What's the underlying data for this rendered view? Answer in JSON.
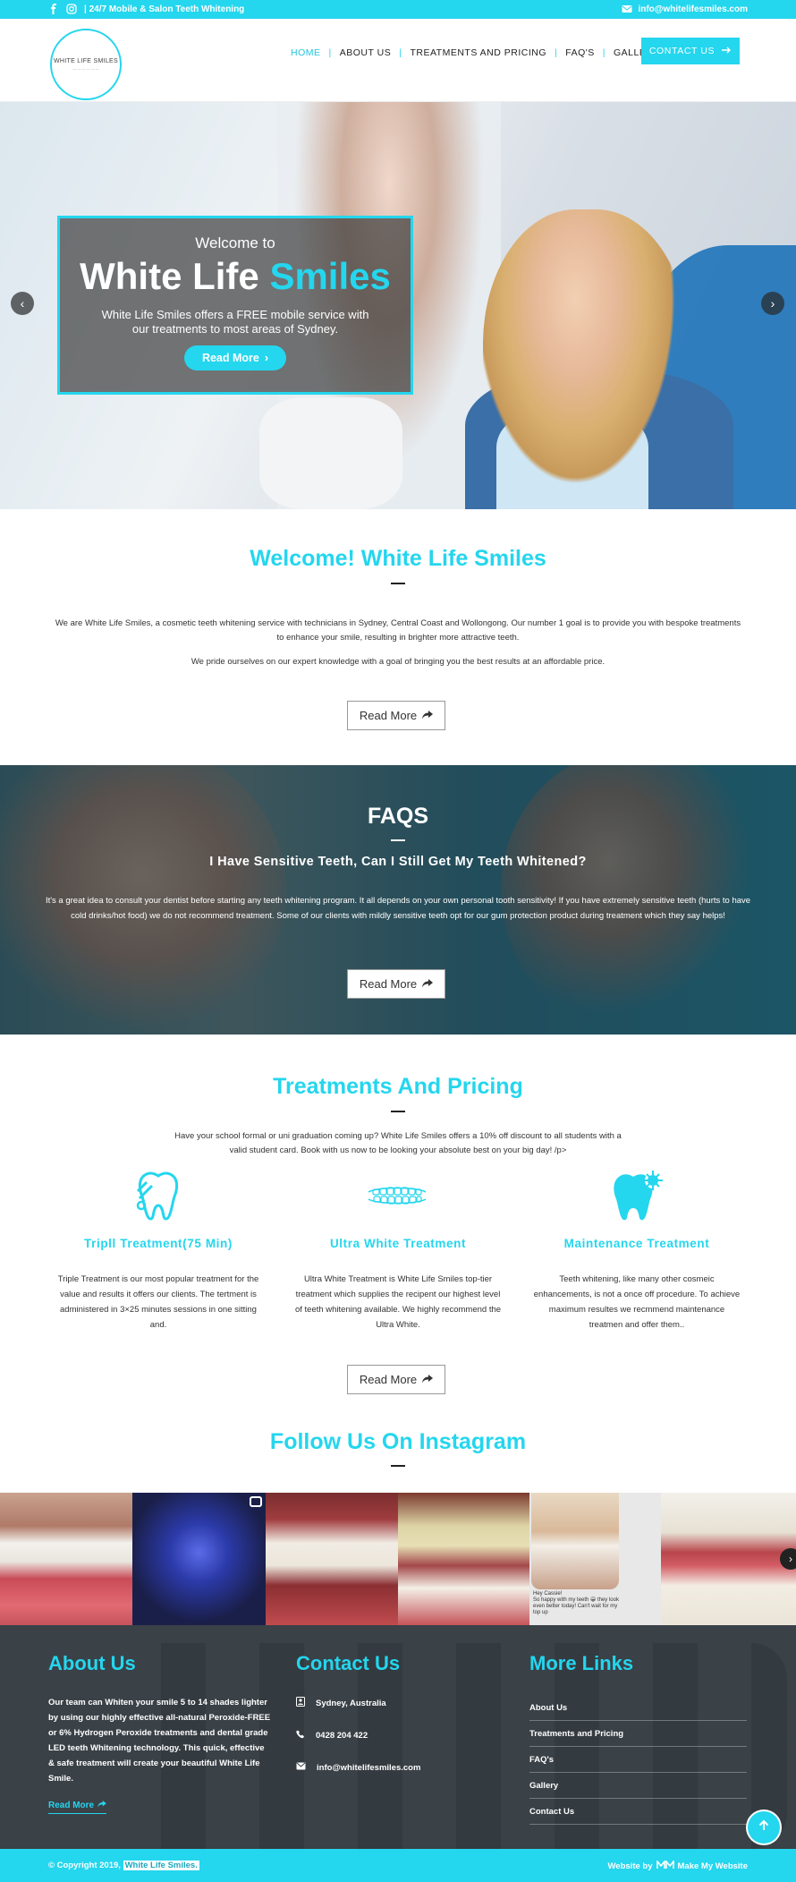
{
  "topbar": {
    "tagline": "| 24/7 Mobile & Salon Teeth Whitening",
    "email": "info@whitelifesmiles.com",
    "icons": [
      "facebook-icon",
      "instagram-icon",
      "envelope-icon"
    ]
  },
  "header": {
    "logo_text": "WHITE LIFE SMILES",
    "nav": [
      {
        "label": "HOME",
        "active": true
      },
      {
        "label": "ABOUT US",
        "active": false
      },
      {
        "label": "TREATMENTS AND PRICING",
        "active": false
      },
      {
        "label": "FAQ'S",
        "active": false
      },
      {
        "label": "GALLERY",
        "active": false
      }
    ],
    "contact_label": "CONTACT US"
  },
  "hero": {
    "welcome": "Welcome to",
    "title_white": "White Life",
    "title_cyan": "Smiles",
    "description": "White Life Smiles offers a FREE mobile service with our treatments to most areas of Sydney.",
    "button": "Read More"
  },
  "welcome_section": {
    "title": "Welcome! White Life Smiles",
    "p1": "We are White Life Smiles, a cosmetic teeth whitening service with technicians in Sydney, Central Coast and Wollongong. Our number 1 goal is to provide you with bespoke treatments to enhance your smile, resulting in brighter more attractive teeth.",
    "p2": "We pride ourselves on our expert knowledge with a goal of bringing you the best results at an affordable price.",
    "button": "Read More"
  },
  "faq": {
    "title": "FAQS",
    "question": "I Have Sensitive Teeth, Can I Still Get My Teeth Whitened?",
    "answer": "It's a great idea to consult your dentist before starting any teeth whitening program. It all depends on your own personal tooth sensitivity! If you have extremely sensitive teeth (hurts to have cold drinks/hot food) we do not recommend treatment. Some of our clients with mildly sensitive teeth opt for our gum protection product during treatment which they say helps!",
    "button": "Read More"
  },
  "treatments": {
    "title": "Treatments And Pricing",
    "intro": "Have your school formal or uni graduation coming up? White Life Smiles offers a 10% off discount to all students with a valid student card. Book with us now to be looking your absolute best on your big day! /p>",
    "items": [
      {
        "icon": "tooth-repair-icon",
        "title": "Tripll Treatment(75 Min)",
        "desc": "Triple Treatment is our most popular treatment for the value and results it offers our clients. The tertment is administered in 3×25 minutes sessions in one sitting and."
      },
      {
        "icon": "teeth-row-icon",
        "title": "Ultra White Treatment",
        "desc": "Ultra White Treatment is White Life Smiles top-tier treatment which supplies the recipent our highest level of teeth whitening available. We highly recommend the Ultra White."
      },
      {
        "icon": "tooth-sparkle-icon",
        "title": "Maintenance Treatment",
        "desc": "Teeth whitening, like many other cosmeic enhancements, is not a once off procedure. To achieve maximum resultes we recmmend maintenance treatmen and offer them.."
      }
    ],
    "button": "Read More"
  },
  "instagram": {
    "title": "Follow Us On Instagram",
    "chat_text": "Hey Cassie!\nSo happy with my teeth 😀 they look even better today! Can't wait for my top up"
  },
  "footer": {
    "about_title": "About Us",
    "about_text": "Our team can Whiten your smile 5 to 14 shades lighter by using our highly effective all-natural Peroxide-FREE or 6% Hydrogen Peroxide treatments and dental grade LED teeth Whitening technology. This quick, effective & safe treatment will create your beautiful White Life Smile.",
    "about_link": "Read More",
    "contact_title": "Contact Us",
    "address": "Sydney, Australia",
    "phone": "0428 204 422",
    "email": "info@whitelifesmiles.com",
    "links_title": "More Links",
    "links": [
      "About Us",
      "Treatments and Pricing",
      "FAQ's",
      "Gallery",
      "Contact Us"
    ]
  },
  "copyright": {
    "prefix": "© Copyright 2019,",
    "brand": "White Life Smiles.",
    "credit_prefix": "Website by",
    "credit_brand": "Make My Website"
  },
  "colors": {
    "accent": "#24d6ee",
    "footer_bg": "#3a4147",
    "text": "#333333"
  }
}
